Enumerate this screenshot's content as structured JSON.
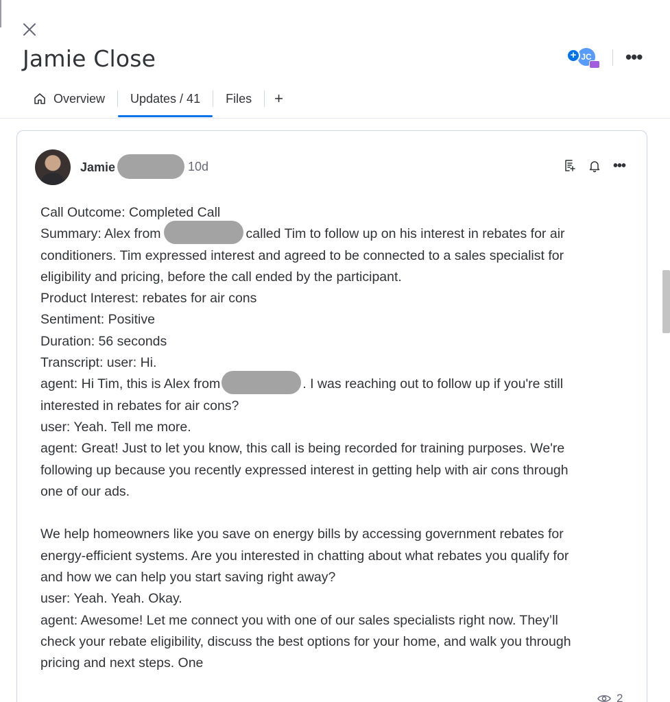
{
  "item": {
    "title": "Jamie Close",
    "avatar_initials": "JC"
  },
  "tabs": [
    {
      "label": "Overview",
      "icon": "home-icon"
    },
    {
      "label": "Updates / 41"
    },
    {
      "label": "Files"
    },
    {
      "label": "+"
    }
  ],
  "active_tab": "Updates / 41",
  "update": {
    "author_first_name": "Jamie",
    "time_ago": "10d",
    "views_count": "2",
    "lines": {
      "l1": "Call Outcome: Completed Call",
      "l2a": "Summary: Alex from",
      "l2b": "called Tim to follow up on his interest in rebates for air",
      "l3": "conditioners. Tim expressed interest and agreed to be connected to a sales specialist for",
      "l4": "eligibility and pricing, before the call ended by the participant.",
      "l5": "Product Interest: rebates for air cons",
      "l6": "Sentiment: Positive",
      "l7": "Duration: 56 seconds",
      "l8": "Transcript: user: Hi.",
      "l9a": "agent: Hi Tim, this is Alex from",
      "l9b": ". I was reaching out to follow up if you're still",
      "l10": "interested in rebates for air cons?",
      "l11": "user: Yeah. Tell me more.",
      "l12": "agent: Great! Just to let you know, this call is being recorded for training purposes. We're",
      "l13": "following up because you recently expressed interest in getting help with air cons through",
      "l14": "one of our ads.",
      "l15": "We help homeowners like you save on energy bills by accessing government rebates for",
      "l16": "energy-efficient systems. Are you interested in chatting about what rebates you qualify for",
      "l17": "and how we can help you start saving right away?",
      "l18": "user: Yeah. Yeah. Okay.",
      "l19": "agent: Awesome! Let me connect you with one of our sales specialists right now. They’ll",
      "l20": "check your rebate eligibility, discuss the best options for your home, and walk you through",
      "l21": "pricing and next steps. One"
    }
  },
  "colors": {
    "accent": "#0073ea",
    "text": "#323338",
    "muted": "#676879",
    "redaction": "#a3a3a3"
  }
}
